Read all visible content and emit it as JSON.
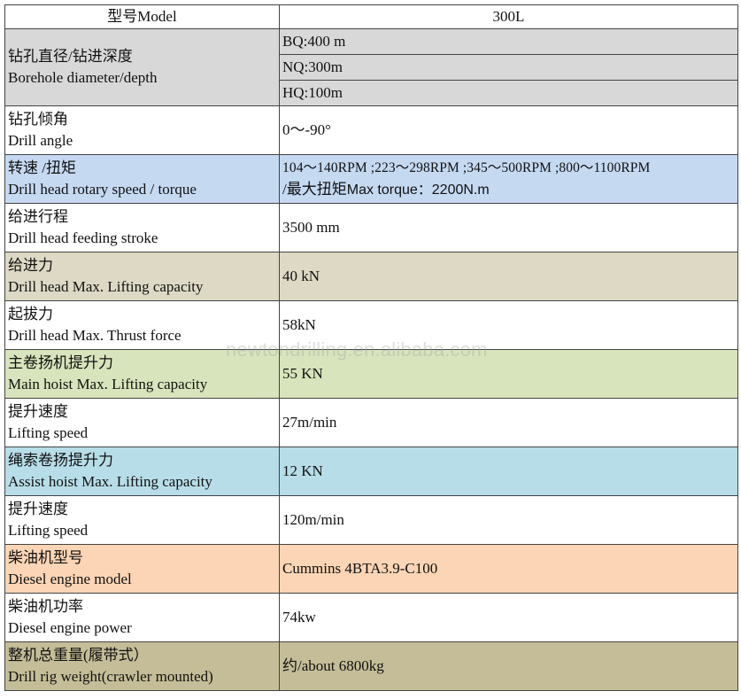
{
  "colors": {
    "gray": "#d8d8d8",
    "blue": "#c5d9f1",
    "tan": "#ddd9c4",
    "green": "#d8e4bc",
    "lightblue": "#b7dde8",
    "peach": "#fbd5b5",
    "olive": "#c4bd97",
    "white": "#ffffff"
  },
  "header": {
    "label": "型号Model",
    "value": "300L"
  },
  "borehole": {
    "label_cn": "钻孔直径/钻进深度",
    "label_en": "Borehole diameter/depth",
    "values": [
      "BQ:400 m",
      "NQ:300m",
      "HQ:100m"
    ]
  },
  "rows": [
    {
      "label_cn": "钻孔倾角",
      "label_en": "Drill angle",
      "value": "0～-90°",
      "color": "#ffffff"
    },
    {
      "label_cn": "转速 /扭矩",
      "label_en": "Drill head rotary speed / torque",
      "value": "104～140RPM ;223～298RPM ;345～500RPM   ;800～1100RPM",
      "value2_prefix": "/最大扭矩",
      "value2": "Max torque：2200N.m",
      "color": "#c5d9f1"
    },
    {
      "label_cn": "给进行程",
      "label_en": "Drill head feeding stroke",
      "value": "3500 mm",
      "color": "#ffffff"
    },
    {
      "label_cn": "给进力",
      "label_en": "Drill head Max. Lifting capacity",
      "value": "40 kN",
      "color": "#ddd9c4"
    },
    {
      "label_cn": "起拔力",
      "label_en": "Drill head Max. Thrust force",
      "value": "58kN",
      "color": "#ffffff"
    },
    {
      "label_cn": "主卷扬机提升力",
      "label_en": "Main hoist Max. Lifting capacity",
      "value": "55 KN",
      "color": "#d8e4bc"
    },
    {
      "label_cn": "提升速度",
      "label_en": "Lifting speed",
      "value": "27m/min",
      "color": "#ffffff"
    },
    {
      "label_cn": "绳索卷扬提升力",
      "label_en": "Assist hoist Max. Lifting capacity",
      "value": "12 KN",
      "color": "#b7dde8"
    },
    {
      "label_cn": "提升速度",
      "label_en": "Lifting speed",
      "value": "120m/min",
      "color": "#ffffff"
    },
    {
      "label_cn": "柴油机型号",
      "label_en": "Diesel engine model",
      "value": "Cummins 4BTA3.9-C100",
      "color": "#fbd5b5"
    },
    {
      "label_cn": "柴油机功率",
      "label_en": "Diesel engine power",
      "value": "74kw",
      "color": "#ffffff"
    },
    {
      "label_cn": "整机总重量(履带式）",
      "label_en": "Drill rig weight(crawler mounted)",
      "value": "约/about 6800kg",
      "color": "#c4bd97"
    }
  ],
  "watermark": "newtondrilling.en.alibaba.com"
}
